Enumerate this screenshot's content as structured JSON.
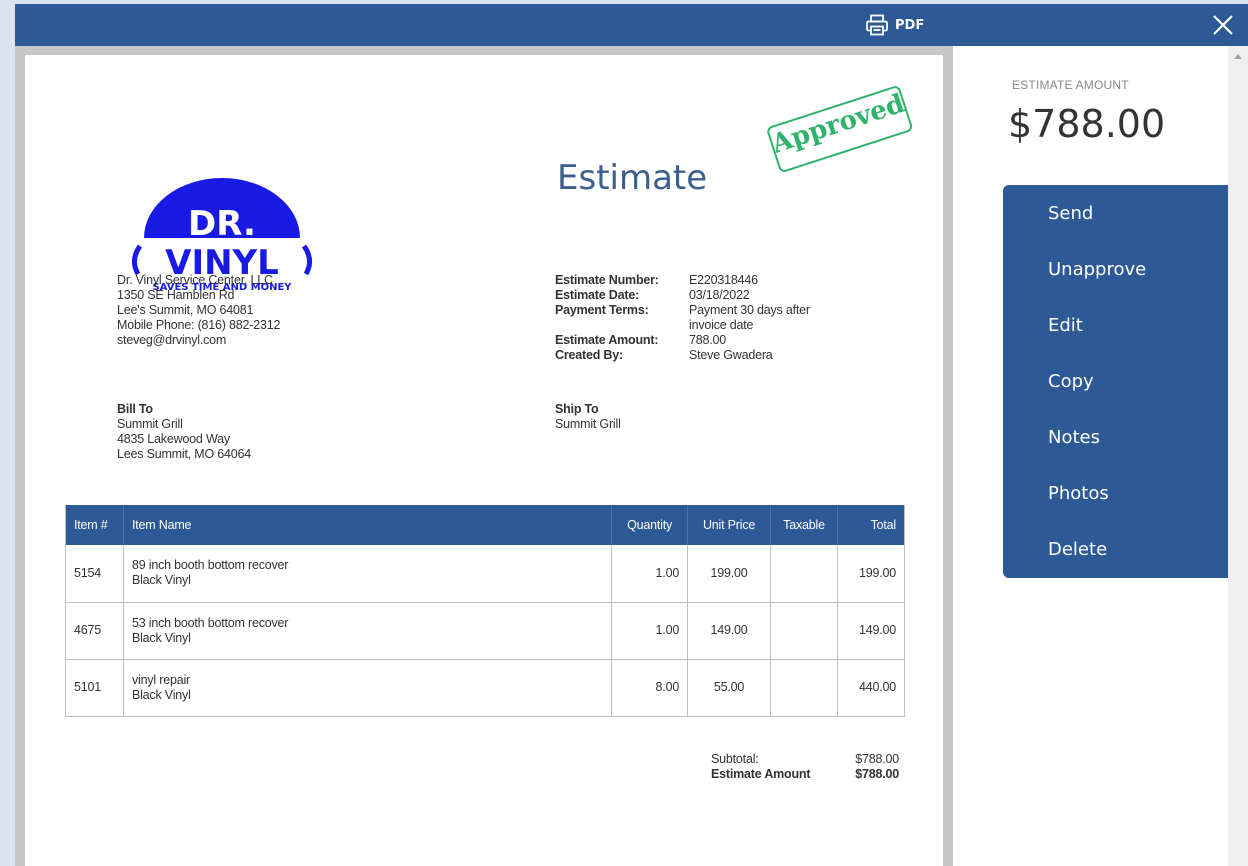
{
  "toolbar": {
    "pdf_label": "PDF",
    "icons": [
      "printer-icon",
      "close-icon"
    ]
  },
  "document": {
    "title": "Estimate",
    "stamp": "Approved",
    "logo": {
      "line1": "DR.",
      "line2": "VINYL",
      "tagline": "SAVES TIME AND MONEY"
    },
    "company": {
      "name": "Dr. Vinyl Service Center, LLC",
      "street": "1350 SE Hamblen Rd",
      "city": "Lee's Summit, MO 64081",
      "phone": "Mobile Phone: (816) 882-2312",
      "email": "steveg@drvinyl.com"
    },
    "meta": [
      {
        "label": "Estimate Number:",
        "value": "E220318446"
      },
      {
        "label": "Estimate Date:",
        "value": "03/18/2022"
      },
      {
        "label": "Payment Terms:",
        "value": "Payment 30 days after invoice date"
      },
      {
        "label": "Estimate Amount:",
        "value": "788.00"
      },
      {
        "label": "Created By:",
        "value": "Steve Gwadera"
      }
    ],
    "bill_to": {
      "label": "Bill To",
      "name": "Summit Grill",
      "street": "4835 Lakewood Way",
      "city": "Lees Summit, MO 64064"
    },
    "ship_to": {
      "label": "Ship To",
      "name": "Summit Grill"
    },
    "table": {
      "headers": [
        "Item #",
        "Item Name",
        "Quantity",
        "Unit Price",
        "Taxable",
        "Total"
      ],
      "rows": [
        {
          "item": "5154",
          "name": "89 inch booth bottom recover",
          "desc": "Black Vinyl",
          "qty": "1.00",
          "price": "199.00",
          "taxable": "",
          "total": "199.00"
        },
        {
          "item": "4675",
          "name": "53 inch booth bottom recover",
          "desc": "Black Vinyl",
          "qty": "1.00",
          "price": "149.00",
          "taxable": "",
          "total": "149.00"
        },
        {
          "item": "5101",
          "name": "vinyl repair",
          "desc": "Black Vinyl",
          "qty": "8.00",
          "price": "55.00",
          "taxable": "",
          "total": "440.00"
        }
      ]
    },
    "totals": [
      {
        "label": "Subtotal:",
        "value": "$788.00"
      },
      {
        "label": "Estimate Amount",
        "value": "$788.00"
      }
    ]
  },
  "sidebar": {
    "amount_label": "ESTIMATE AMOUNT",
    "amount_value": "$788.00",
    "actions": [
      "Send",
      "Unapprove",
      "Edit",
      "Copy",
      "Notes",
      "Photos",
      "Delete"
    ]
  },
  "colors": {
    "primary": "#2d5a96",
    "stamp": "#2fb36c",
    "logo": "#1a1ae6"
  }
}
